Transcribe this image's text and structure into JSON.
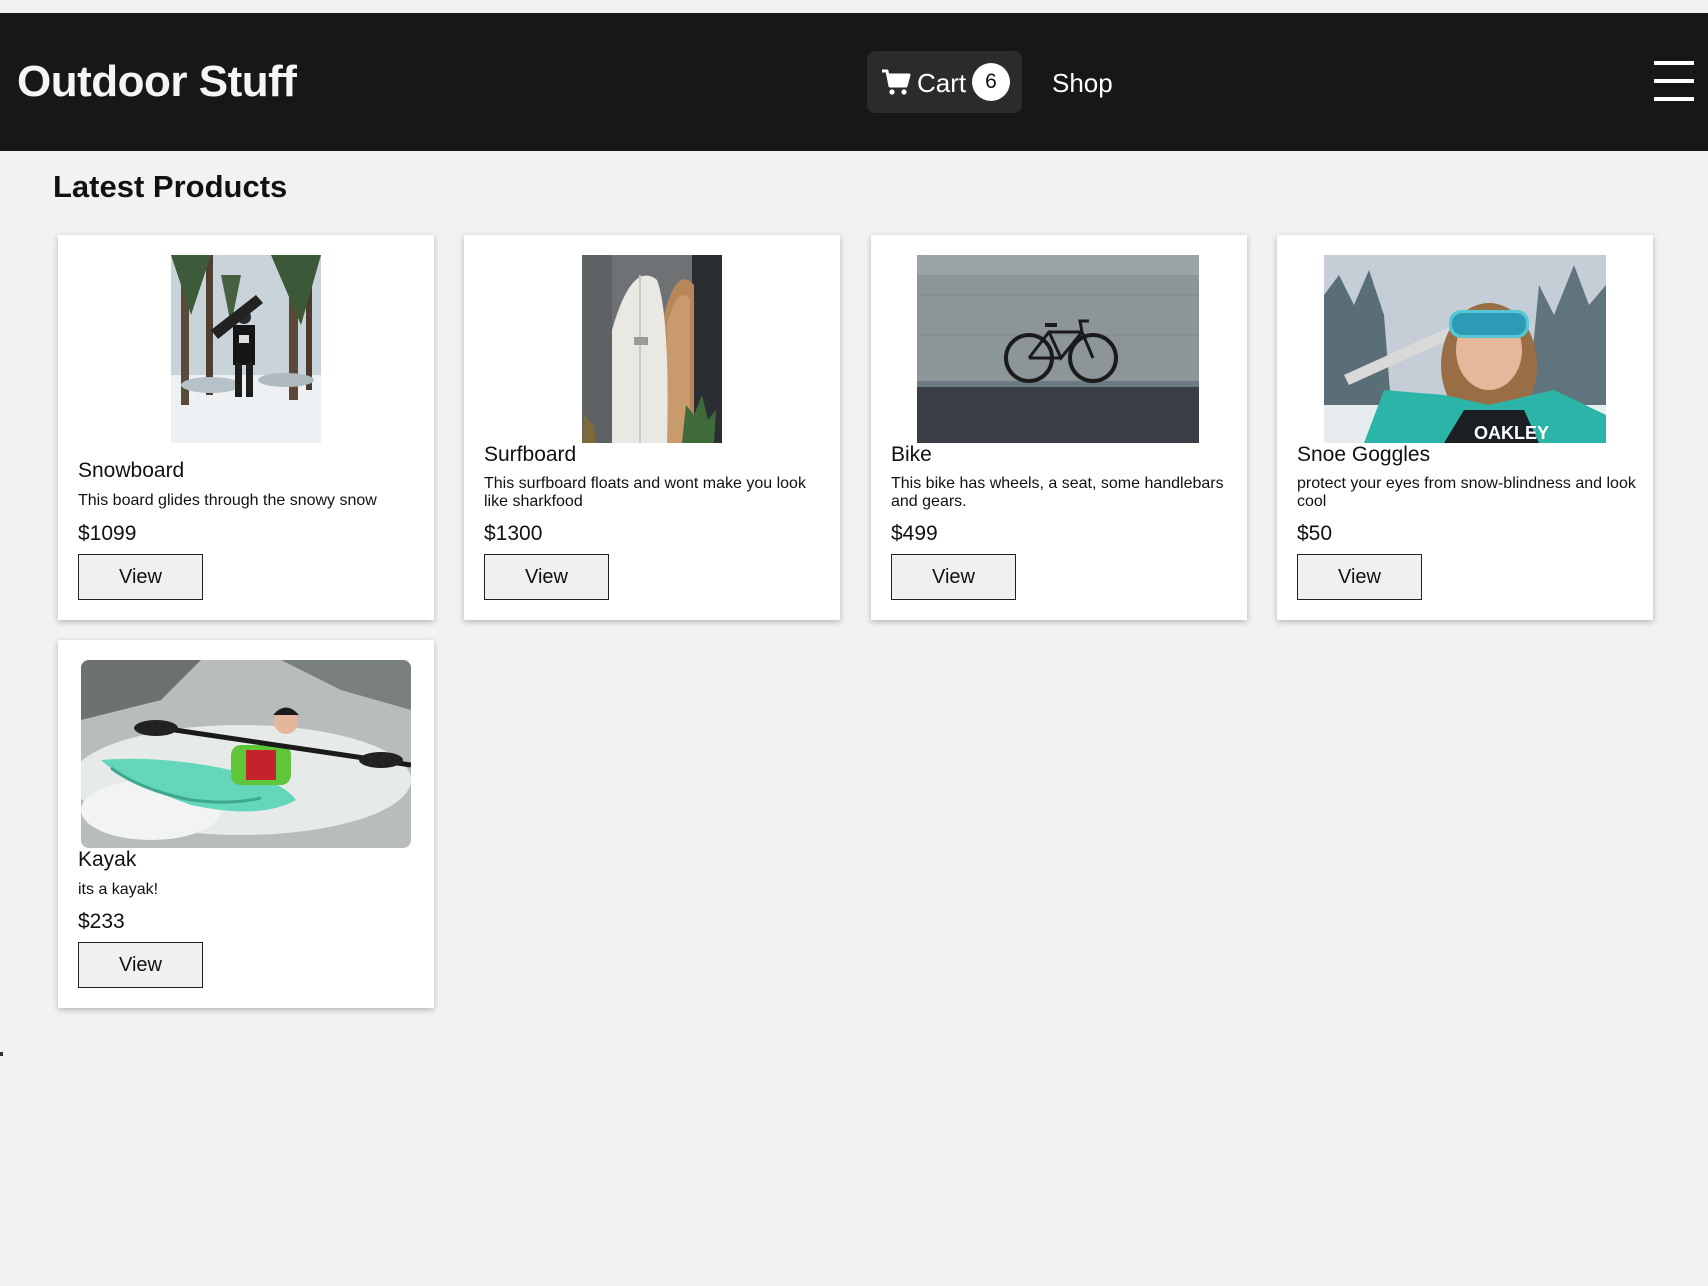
{
  "header": {
    "brand": "Outdoor Stuff",
    "cart_label": "Cart",
    "cart_count": "6",
    "shop_label": "Shop",
    "cart_icon": "shopping-cart-icon",
    "menu_icon": "hamburger-menu-icon"
  },
  "main": {
    "title": "Latest Products",
    "products": [
      {
        "name": "Snowboard",
        "description": "This board glides through the snowy snow",
        "price": "$1099",
        "button": "View",
        "image": "person holding snowboard in snowy forest"
      },
      {
        "name": "Surfboard",
        "description": "This surfboard floats and wont make you look like sharkfood",
        "price": "$1300",
        "button": "View",
        "image": "surfboards leaning on wall"
      },
      {
        "name": "Bike",
        "description": "This bike has wheels, a seat, some handlebars and gears.",
        "price": "$499",
        "button": "View",
        "image": "bike against concrete wall"
      },
      {
        "name": "Snoe Goggles",
        "description": "protect your eyes from snow-blindness and look cool",
        "price": "$50",
        "button": "View",
        "image": "woman wearing ski goggles"
      },
      {
        "name": "Kayak",
        "description": "its a kayak!",
        "price": "$233",
        "button": "View",
        "image": "kayaker in whitewater"
      }
    ]
  },
  "colors": {
    "navbar": "#171717",
    "background": "#f2f2f2",
    "card": "#ffffff",
    "cart_button": "#2b2b2b"
  }
}
